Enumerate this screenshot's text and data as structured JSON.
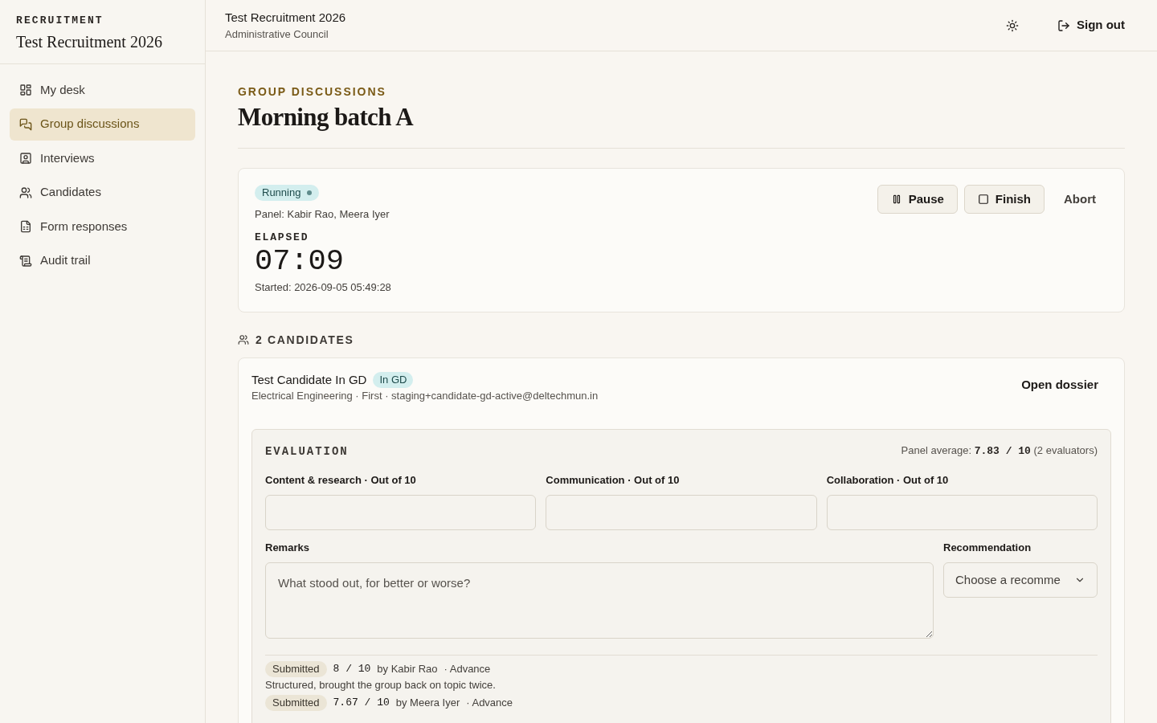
{
  "sidebar": {
    "eyebrow": "RECRUITMENT",
    "title": "Test Recruitment 2026",
    "items": [
      {
        "label": "My desk",
        "selected": false
      },
      {
        "label": "Group discussions",
        "selected": true
      },
      {
        "label": "Interviews",
        "selected": false
      },
      {
        "label": "Candidates",
        "selected": false
      },
      {
        "label": "Form responses",
        "selected": false
      },
      {
        "label": "Audit trail",
        "selected": false
      }
    ]
  },
  "header": {
    "title": "Test Recruitment 2026",
    "subtitle": "Administrative Council",
    "sign_out": "Sign out"
  },
  "page": {
    "eyebrow": "GROUP DISCUSSIONS",
    "title": "Morning batch A"
  },
  "session": {
    "status": "Running",
    "panel": "Panel: Kabir Rao, Meera Iyer",
    "elapsed_label": "ELAPSED",
    "elapsed": "07:09",
    "started": "Started: 2026-09-05 05:49:28",
    "actions": [
      {
        "label": "Pause",
        "kind": "outlined"
      },
      {
        "label": "Finish",
        "kind": "outlined"
      },
      {
        "label": "Abort",
        "kind": "plain"
      }
    ]
  },
  "candidates": {
    "heading": "2 CANDIDATES",
    "items": [
      {
        "name": "Test Candidate In GD",
        "status": "In GD",
        "details": "Electrical Engineering · First · staging+candidate-gd-active@deltechmun.in",
        "action": "Open dossier",
        "evaluation": {
          "heading": "EVALUATION",
          "panel_average": "Panel average: **7.83 / 10** (2 evaluators)",
          "criteria": [
            {
              "label": "Content & research · Out of 10"
            },
            {
              "label": "Communication · Out of 10"
            },
            {
              "label": "Collaboration · Out of 10"
            }
          ],
          "remarks": {
            "label": "Remarks",
            "placeholder": "What stood out, for better or worse?"
          },
          "recommendation": {
            "label": "Recommendation",
            "placeholder": "Choose a recomme"
          },
          "submissions": [
            {
              "status": "Submitted",
              "score": "8 / 10",
              "evaluator": "by Kabir Rao",
              "recommendation": "· Advance",
              "comment": "Structured, brought the group back on topic twice."
            },
            {
              "status": "Submitted",
              "score": "7.67 / 10",
              "evaluator": "by Meera Iyer",
              "recommendation": "· Advance"
            }
          ]
        }
      }
    ]
  }
}
